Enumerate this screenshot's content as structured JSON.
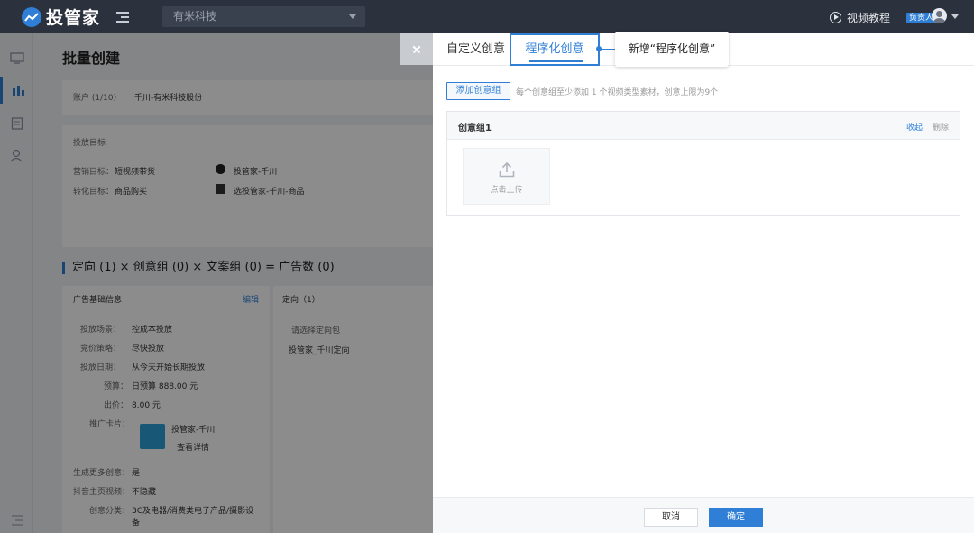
{
  "header": {
    "brand": "投管家",
    "company_select": "有米科技",
    "video_tutorial": "视频教程",
    "user_badge": "负责人"
  },
  "page": {
    "title": "批量创建",
    "account_label": "账户 (1/10)",
    "account_value": "千川-有米科技股份",
    "target_section": "投放目标",
    "marketing_goal_label": "营销目标：",
    "marketing_goal_value": "短视频带货",
    "conversion_goal_label": "转化目标：",
    "conversion_goal_value": "商品购买",
    "target_account": "投管家-千川",
    "target_product": "选投管家-千川-商品",
    "formula": "定向 (1) × 创意组 (0) × 文案组 (0) = 广告数 (0)",
    "ad_basic_info": "广告基础信息",
    "edit_link": "编辑",
    "targeting_header": "定向（1）",
    "targeting_placeholder": "请选择定向包",
    "targeting_item": "投管家_千川定向",
    "fields": [
      {
        "label": "投放场景：",
        "value": "控成本投放"
      },
      {
        "label": "竞价策略：",
        "value": "尽快投放"
      },
      {
        "label": "投放日期：",
        "value": "从今天开始长期投放"
      },
      {
        "label": "预算：",
        "value": "日预算 888.00 元"
      },
      {
        "label": "出价：",
        "value": "8.00 元"
      }
    ],
    "promo_card_label": "推广卡片：",
    "promo_card_name": "投管家-千川",
    "promo_card_link": "查看详情",
    "more_fields": [
      {
        "label": "生成更多创意：",
        "value": "是"
      },
      {
        "label": "抖音主页视频：",
        "value": "不隐藏"
      },
      {
        "label": "创意分类：",
        "value": "3C及电器/消费类电子产品/摄影设备"
      }
    ]
  },
  "drawer": {
    "tab_custom": "自定义创意",
    "tab_programmatic": "程序化创意",
    "callout": "新增“程序化创意”",
    "add_group_button": "添加创意组",
    "hint": "每个创意组至少添加 1 个视频类型素材，创意上限为9个",
    "group_title": "创意组1",
    "collapse": "收起",
    "delete": "删除",
    "upload": "点击上传",
    "cancel": "取消",
    "confirm": "确定"
  },
  "colors": {
    "accent": "#2f7fd6",
    "topbar": "#2b313d"
  }
}
